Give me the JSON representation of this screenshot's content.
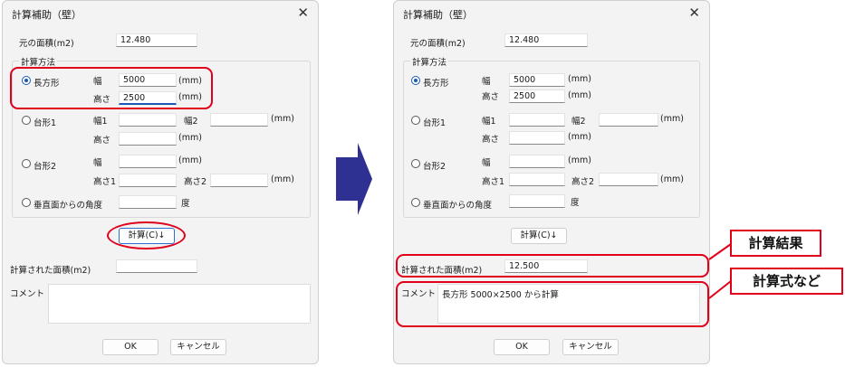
{
  "before": {
    "title": "計算補助（壁）",
    "orig_area_label": "元の面積(m2)",
    "orig_area_value": "12.480",
    "method_group_label": "計算方法",
    "rect": {
      "label": "長方形",
      "w_label": "幅",
      "w_value": "5000",
      "h_label": "高さ",
      "h_value": "2500"
    },
    "trap1": {
      "label": "台形1",
      "w1_label": "幅1",
      "w2_label": "幅2",
      "h_label": "高さ"
    },
    "trap2": {
      "label": "台形2",
      "w_label": "幅",
      "h1_label": "高さ1",
      "h2_label": "高さ2"
    },
    "vert": {
      "label": "垂直面からの角度",
      "unit": "度"
    },
    "unit_mm": "(mm)",
    "calc_button": "計算(C)↓",
    "result_label": "計算された面積(m2)",
    "result_value": "",
    "comment_label": "コメント",
    "comment_value": "",
    "ok": "OK",
    "cancel": "キャンセル"
  },
  "after": {
    "title": "計算補助（壁）",
    "orig_area_label": "元の面積(m2)",
    "orig_area_value": "12.480",
    "method_group_label": "計算方法",
    "rect": {
      "label": "長方形",
      "w_label": "幅",
      "w_value": "5000",
      "h_label": "高さ",
      "h_value": "2500"
    },
    "trap1": {
      "label": "台形1",
      "w1_label": "幅1",
      "w2_label": "幅2",
      "h_label": "高さ"
    },
    "trap2": {
      "label": "台形2",
      "w_label": "幅",
      "h1_label": "高さ1",
      "h2_label": "高さ2"
    },
    "vert": {
      "label": "垂直面からの角度",
      "unit": "度"
    },
    "unit_mm": "(mm)",
    "calc_button": "計算(C)↓",
    "result_label": "計算された面積(m2)",
    "result_value": "12.500",
    "comment_label": "コメント",
    "comment_value": "長方形 5000×2500 から計算",
    "ok": "OK",
    "cancel": "キャンセル"
  },
  "callouts": {
    "result": "計算結果",
    "formula": "計算式など"
  },
  "colors": {
    "highlight": "#e0001a",
    "arrow": "#2e3192",
    "accent": "#1a5ab4"
  }
}
